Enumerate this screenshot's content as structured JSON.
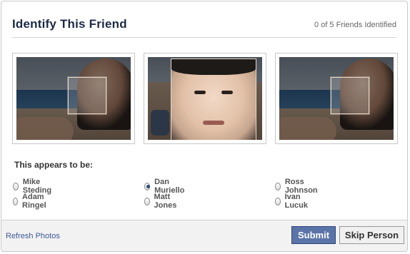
{
  "dialog": {
    "title": "Identify This Friend",
    "counter": "0 of 5 Friends Identified",
    "prompt": "This appears to be:",
    "options": [
      {
        "label": "Mike Steding",
        "checked": false
      },
      {
        "label": "Adam Ringel",
        "checked": false
      },
      {
        "label": "Dan Muriello",
        "checked": true
      },
      {
        "label": "Matt Jones",
        "checked": false
      },
      {
        "label": "Ross Johnson",
        "checked": false
      },
      {
        "label": "Ivan Lucuk",
        "checked": false
      }
    ],
    "refresh_label": "Refresh Photos",
    "submit_label": "Submit",
    "skip_label": "Skip Person"
  },
  "colors": {
    "title": "#1c2a47",
    "link": "#3b5998",
    "submit_bg": "#5b74a8"
  }
}
